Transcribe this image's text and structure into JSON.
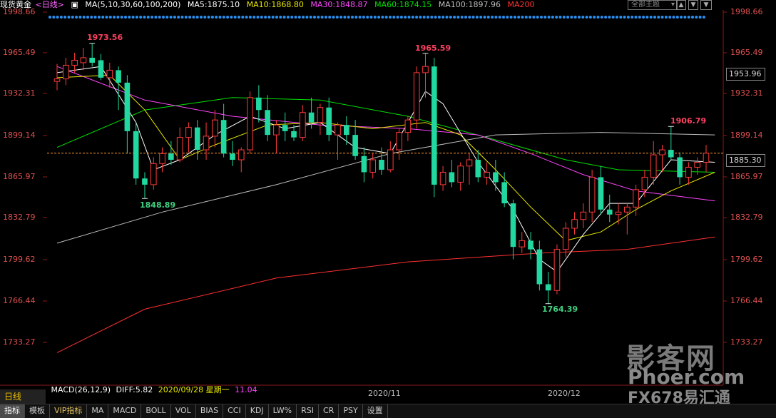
{
  "header": {
    "instrument": "现货黄金",
    "period": "<日线>",
    "ma_params": "MA(5,10,30,60,100,200)",
    "ma5": "MA5:1875.10",
    "ma10": "MA10:1868.80",
    "ma30": "MA30:1848.87",
    "ma60": "MA60:1874.15",
    "ma100": "MA100:1897.96",
    "ma200": "MA200",
    "select_label": "全部主题",
    "colors": {
      "instrument": "#ffffff",
      "period": "#ff66ff",
      "ma_params": "#ffffff",
      "ma5": "#ffffff",
      "ma10": "#e8e800",
      "ma30": "#ff44ff",
      "ma60": "#00e000",
      "ma100": "#bbbbbb",
      "ma200": "#ff3030"
    }
  },
  "price_axis": {
    "ticks": [
      "1998.66",
      "1965.49",
      "1932.31",
      "1899.14",
      "1865.97",
      "1832.79",
      "1799.62",
      "1766.44",
      "1733.27"
    ],
    "right_box_upper": "1953.96",
    "right_box_current": "1885.30"
  },
  "annotations": {
    "peak1": "1973.56",
    "low1": "1848.89",
    "peak2": "1965.59",
    "low2": "1764.39",
    "peak3": "1906.79"
  },
  "bottom": {
    "period_tab": "日线",
    "macd_label": "MACD(26,12,9)",
    "diff_label": "DIFF:5.82",
    "date_overlay": "2020/09/28 星期一",
    "macd_value": "11.04",
    "x_labels": [
      "2020/11",
      "2020/12"
    ]
  },
  "tabs": [
    {
      "label": "指标",
      "active": true
    },
    {
      "label": "模板"
    },
    {
      "label": "VIP指标",
      "vip": true
    },
    {
      "label": "MA"
    },
    {
      "label": "MACD"
    },
    {
      "label": "BOLL"
    },
    {
      "label": "VOL"
    },
    {
      "label": "BIAS"
    },
    {
      "label": "CCI"
    },
    {
      "label": "KDJ"
    },
    {
      "label": "LW%"
    },
    {
      "label": "RSI"
    },
    {
      "label": "CR"
    },
    {
      "label": "PSY"
    },
    {
      "label": "设置"
    }
  ],
  "watermark": {
    "line1": "影客网",
    "line2": "Phoer.com",
    "line3": "FX678易汇通"
  },
  "chart_data": {
    "type": "candlestick",
    "y_range": [
      1720,
      2005
    ],
    "current_price": 1885.3,
    "candles": [
      [
        1943,
        1957,
        1936,
        1945
      ],
      [
        1945,
        1962,
        1940,
        1956
      ],
      [
        1956,
        1966,
        1950,
        1960
      ],
      [
        1958,
        1970,
        1952,
        1962
      ],
      [
        1962,
        1973.56,
        1955,
        1958
      ],
      [
        1960,
        1965,
        1944,
        1946
      ],
      [
        1946,
        1958,
        1938,
        1952
      ],
      [
        1952,
        1955,
        1920,
        1942
      ],
      [
        1942,
        1948,
        1885,
        1903
      ],
      [
        1903,
        1910,
        1860,
        1865
      ],
      [
        1865,
        1870,
        1848.89,
        1860
      ],
      [
        1860,
        1882,
        1856,
        1877
      ],
      [
        1877,
        1890,
        1870,
        1885
      ],
      [
        1885,
        1895,
        1876,
        1880
      ],
      [
        1880,
        1906,
        1878,
        1898
      ],
      [
        1898,
        1910,
        1886,
        1906
      ],
      [
        1906,
        1912,
        1880,
        1888
      ],
      [
        1888,
        1910,
        1880,
        1899
      ],
      [
        1899,
        1920,
        1890,
        1912
      ],
      [
        1912,
        1925,
        1882,
        1885
      ],
      [
        1885,
        1895,
        1875,
        1880
      ],
      [
        1880,
        1890,
        1870,
        1888
      ],
      [
        1888,
        1935,
        1885,
        1930
      ],
      [
        1930,
        1940,
        1910,
        1920
      ],
      [
        1920,
        1932,
        1895,
        1900
      ],
      [
        1900,
        1912,
        1885,
        1908
      ],
      [
        1908,
        1918,
        1895,
        1903
      ],
      [
        1903,
        1908,
        1895,
        1898
      ],
      [
        1898,
        1924,
        1895,
        1918
      ],
      [
        1918,
        1930,
        1905,
        1910
      ],
      [
        1910,
        1925,
        1900,
        1922
      ],
      [
        1922,
        1930,
        1895,
        1900
      ],
      [
        1900,
        1910,
        1880,
        1908
      ],
      [
        1908,
        1915,
        1892,
        1900
      ],
      [
        1900,
        1912,
        1880,
        1883
      ],
      [
        1883,
        1890,
        1862,
        1870
      ],
      [
        1870,
        1885,
        1865,
        1880
      ],
      [
        1880,
        1890,
        1868,
        1872
      ],
      [
        1872,
        1895,
        1870,
        1888
      ],
      [
        1888,
        1905,
        1880,
        1902
      ],
      [
        1902,
        1915,
        1895,
        1912
      ],
      [
        1912,
        1955,
        1905,
        1950
      ],
      [
        1950,
        1965.59,
        1930,
        1955
      ],
      [
        1955,
        1962,
        1850,
        1860
      ],
      [
        1860,
        1875,
        1855,
        1870
      ],
      [
        1870,
        1880,
        1858,
        1862
      ],
      [
        1862,
        1878,
        1855,
        1875
      ],
      [
        1875,
        1885,
        1860,
        1880
      ],
      [
        1880,
        1888,
        1862,
        1866
      ],
      [
        1866,
        1878,
        1860,
        1870
      ],
      [
        1870,
        1880,
        1855,
        1862
      ],
      [
        1862,
        1870,
        1842,
        1845
      ],
      [
        1845,
        1848,
        1800,
        1810
      ],
      [
        1810,
        1822,
        1805,
        1815
      ],
      [
        1815,
        1822,
        1800,
        1808
      ],
      [
        1808,
        1815,
        1775,
        1780
      ],
      [
        1780,
        1790,
        1764.39,
        1775
      ],
      [
        1775,
        1812,
        1772,
        1808
      ],
      [
        1808,
        1830,
        1802,
        1825
      ],
      [
        1825,
        1838,
        1820,
        1832
      ],
      [
        1832,
        1845,
        1825,
        1838
      ],
      [
        1838,
        1872,
        1830,
        1866
      ],
      [
        1866,
        1875,
        1836,
        1840
      ],
      [
        1840,
        1852,
        1830,
        1836
      ],
      [
        1836,
        1845,
        1828,
        1838
      ],
      [
        1838,
        1845,
        1820,
        1842
      ],
      [
        1842,
        1860,
        1835,
        1856
      ],
      [
        1856,
        1872,
        1850,
        1866
      ],
      [
        1866,
        1895,
        1860,
        1884
      ],
      [
        1884,
        1892,
        1870,
        1888
      ],
      [
        1888,
        1906.79,
        1880,
        1882
      ],
      [
        1882,
        1886,
        1860,
        1866
      ],
      [
        1866,
        1878,
        1860,
        1874
      ],
      [
        1874,
        1882,
        1868,
        1878
      ],
      [
        1878,
        1892,
        1870,
        1885.3
      ]
    ],
    "ma_lines": [
      {
        "name": "MA200",
        "color": "#ff3030",
        "points": [
          [
            0,
            1725
          ],
          [
            10,
            1760
          ],
          [
            25,
            1785
          ],
          [
            40,
            1798
          ],
          [
            55,
            1805
          ],
          [
            65,
            1808
          ],
          [
            75,
            1818
          ]
        ]
      },
      {
        "name": "MA100",
        "color": "#bbbbbb",
        "points": [
          [
            0,
            1813
          ],
          [
            12,
            1838
          ],
          [
            25,
            1860
          ],
          [
            38,
            1885
          ],
          [
            50,
            1900
          ],
          [
            62,
            1902
          ],
          [
            75,
            1900
          ]
        ]
      },
      {
        "name": "MA60",
        "color": "#00e000",
        "points": [
          [
            0,
            1890
          ],
          [
            10,
            1920
          ],
          [
            20,
            1930
          ],
          [
            30,
            1928
          ],
          [
            40,
            1915
          ],
          [
            50,
            1896
          ],
          [
            58,
            1880
          ],
          [
            64,
            1872
          ],
          [
            75,
            1870
          ]
        ]
      },
      {
        "name": "MA30",
        "color": "#ff44ff",
        "points": [
          [
            0,
            1955
          ],
          [
            10,
            1928
          ],
          [
            20,
            1915
          ],
          [
            30,
            1908
          ],
          [
            40,
            1905
          ],
          [
            48,
            1900
          ],
          [
            54,
            1885
          ],
          [
            60,
            1868
          ],
          [
            66,
            1855
          ],
          [
            75,
            1847
          ]
        ]
      },
      {
        "name": "MA10",
        "color": "#e8e800",
        "points": [
          [
            0,
            1946
          ],
          [
            6,
            1948
          ],
          [
            10,
            1920
          ],
          [
            14,
            1880
          ],
          [
            18,
            1892
          ],
          [
            24,
            1908
          ],
          [
            30,
            1910
          ],
          [
            36,
            1905
          ],
          [
            42,
            1910
          ],
          [
            46,
            1900
          ],
          [
            50,
            1872
          ],
          [
            54,
            1842
          ],
          [
            58,
            1815
          ],
          [
            62,
            1822
          ],
          [
            66,
            1840
          ],
          [
            70,
            1855
          ],
          [
            75,
            1870
          ]
        ]
      },
      {
        "name": "MA5",
        "color": "#ffffff",
        "points": [
          [
            0,
            1950
          ],
          [
            5,
            1955
          ],
          [
            9,
            1910
          ],
          [
            11,
            1872
          ],
          [
            14,
            1880
          ],
          [
            18,
            1900
          ],
          [
            22,
            1915
          ],
          [
            26,
            1905
          ],
          [
            30,
            1910
          ],
          [
            34,
            1890
          ],
          [
            38,
            1885
          ],
          [
            42,
            1935
          ],
          [
            44,
            1925
          ],
          [
            48,
            1878
          ],
          [
            52,
            1840
          ],
          [
            55,
            1800
          ],
          [
            57,
            1790
          ],
          [
            60,
            1820
          ],
          [
            63,
            1845
          ],
          [
            66,
            1845
          ],
          [
            70,
            1880
          ],
          [
            75,
            1878
          ]
        ]
      }
    ]
  }
}
